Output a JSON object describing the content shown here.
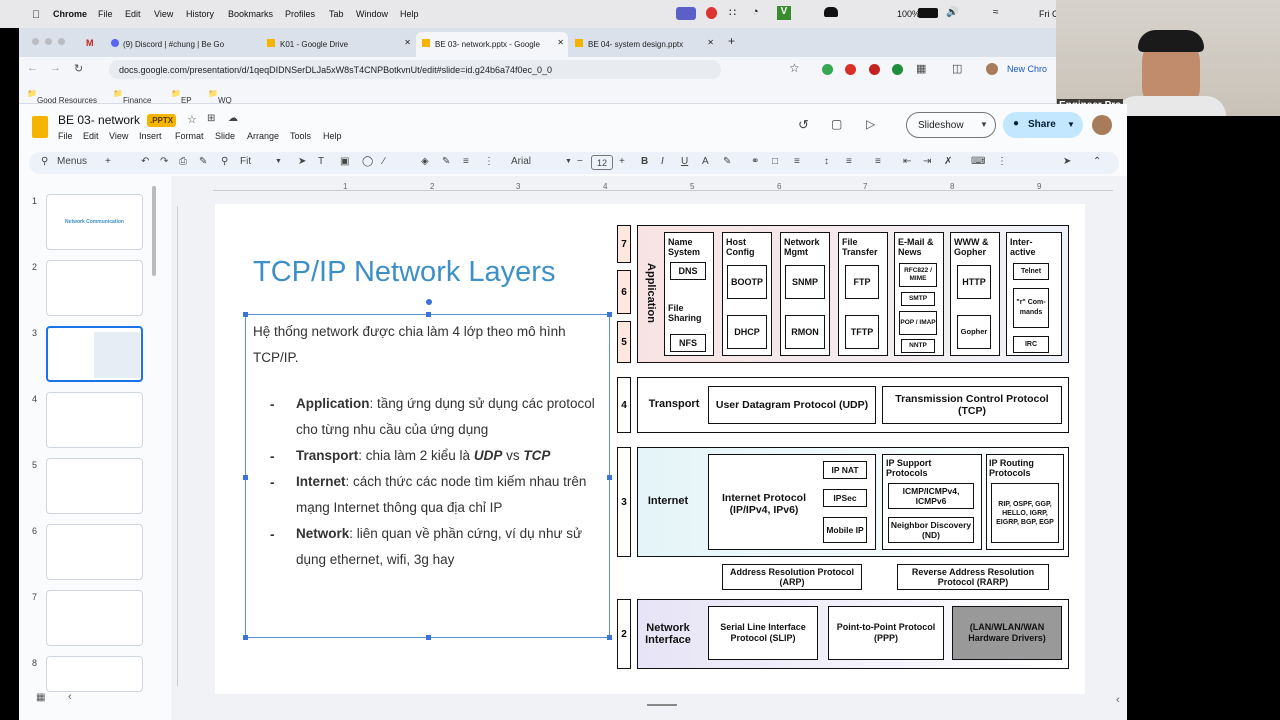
{
  "macos": {
    "app": "Chrome",
    "menus": [
      "File",
      "Edit",
      "View",
      "History",
      "Bookmarks",
      "Profiles",
      "Tab",
      "Window",
      "Help"
    ],
    "battery": "100%",
    "clock": "Fri C"
  },
  "tabs": [
    {
      "label": "(9) Discord | #chung | Be Go"
    },
    {
      "label": "K01 - Google Drive"
    },
    {
      "label": "BE 03- network.pptx - Google"
    },
    {
      "label": "BE 04- system design.pptx"
    }
  ],
  "address": {
    "url": "docs.google.com/presentation/d/1qeqDIDNSerDLJa5xW8sT4CNPBotkvnUt/edit#slide=id.g24b6a74f0ec_0_0",
    "profile_button": "New Chro"
  },
  "bookmarks": [
    "Good Resources",
    "Finance",
    "EP",
    "WQ"
  ],
  "webcam": {
    "name": "Engineer Pro"
  },
  "doc": {
    "title": "BE 03- network",
    "badge": ".PPTX",
    "menus": [
      "File",
      "Edit",
      "View",
      "Insert",
      "Format",
      "Slide",
      "Arrange",
      "Tools",
      "Help"
    ],
    "slideshow": "Slideshow",
    "share": "Share"
  },
  "toolbar": {
    "menus": "Menus",
    "zoom": "Fit",
    "font": "Arial",
    "font_size": "12"
  },
  "ruler": [
    "1",
    "2",
    "3",
    "4",
    "5",
    "6",
    "7",
    "8",
    "9"
  ],
  "thumbnails": [
    {
      "n": "1",
      "title": "Network Communication"
    },
    {
      "n": "2"
    },
    {
      "n": "3"
    },
    {
      "n": "4"
    },
    {
      "n": "5"
    },
    {
      "n": "6"
    },
    {
      "n": "7"
    },
    {
      "n": "8"
    }
  ],
  "slide": {
    "title": "TCP/IP Network Layers",
    "intro": "Hệ thống network được chia làm 4 lớp theo mô hình TCP/IP.",
    "bullets": [
      {
        "term": "Application",
        "text": ": tầng ứng dụng sử dụng các protocol cho từng nhu cầu của ứng dụng"
      },
      {
        "term": "Transport",
        "text": ": chia làm 2 kiểu là ",
        "em1": "UDP",
        "mid": " vs ",
        "em2": "TCP"
      },
      {
        "term": "Internet",
        "text": ": cách thức các node tìm kiếm nhau trên mạng Internet thông qua địa chỉ IP"
      },
      {
        "term": "Network",
        "text": ": liên quan về phần cứng, ví dụ như sử dụng ethernet, wifi, 3g hay"
      }
    ]
  },
  "diagram": {
    "numbers": [
      "7",
      "6",
      "5",
      "4",
      "3",
      "2"
    ],
    "application": "Application",
    "app_groups": [
      "Name System",
      "Host Config",
      "Network Mgmt",
      "File Transfer",
      "E-Mail & News",
      "WWW & Gopher",
      "Inter-active"
    ],
    "file_sharing": "File Sharing",
    "protocols": [
      "DNS",
      "NFS",
      "BOOTP",
      "DHCP",
      "SNMP",
      "RMON",
      "FTP",
      "TFTP",
      "RFC822 / MIME",
      "SMTP",
      "POP / IMAP",
      "NNTP",
      "HTTP",
      "Gopher",
      "Telnet",
      "\"r\" Com-mands",
      "IRC"
    ],
    "transport": "Transport",
    "udp": "User Datagram Protocol (UDP)",
    "tcp": "Transmission Control Protocol (TCP)",
    "internet": "Internet",
    "ip": "Internet Protocol (IP/IPv4, IPv6)",
    "ipnat": "IP NAT",
    "ipsec": "IPSec",
    "mobileip": "Mobile IP",
    "ipsupport": "IP Support Protocols",
    "icmp": "ICMP/ICMPv4, ICMPv6",
    "nd": "Neighbor Discovery (ND)",
    "iprouting": "IP Routing Protocols",
    "routing": "RIP, OSPF, GGP, HELLO, IGRP, EIGRP, BGP, EGP",
    "arp": "Address Resolution Protocol (ARP)",
    "rarp": "Reverse Address Resolution Protocol (RARP)",
    "netif": "Network Interface",
    "slip": "Serial Line Interface Protocol (SLIP)",
    "ppp": "Point-to-Point Protocol (PPP)",
    "lan": "(LAN/WLAN/WAN Hardware Drivers)"
  }
}
